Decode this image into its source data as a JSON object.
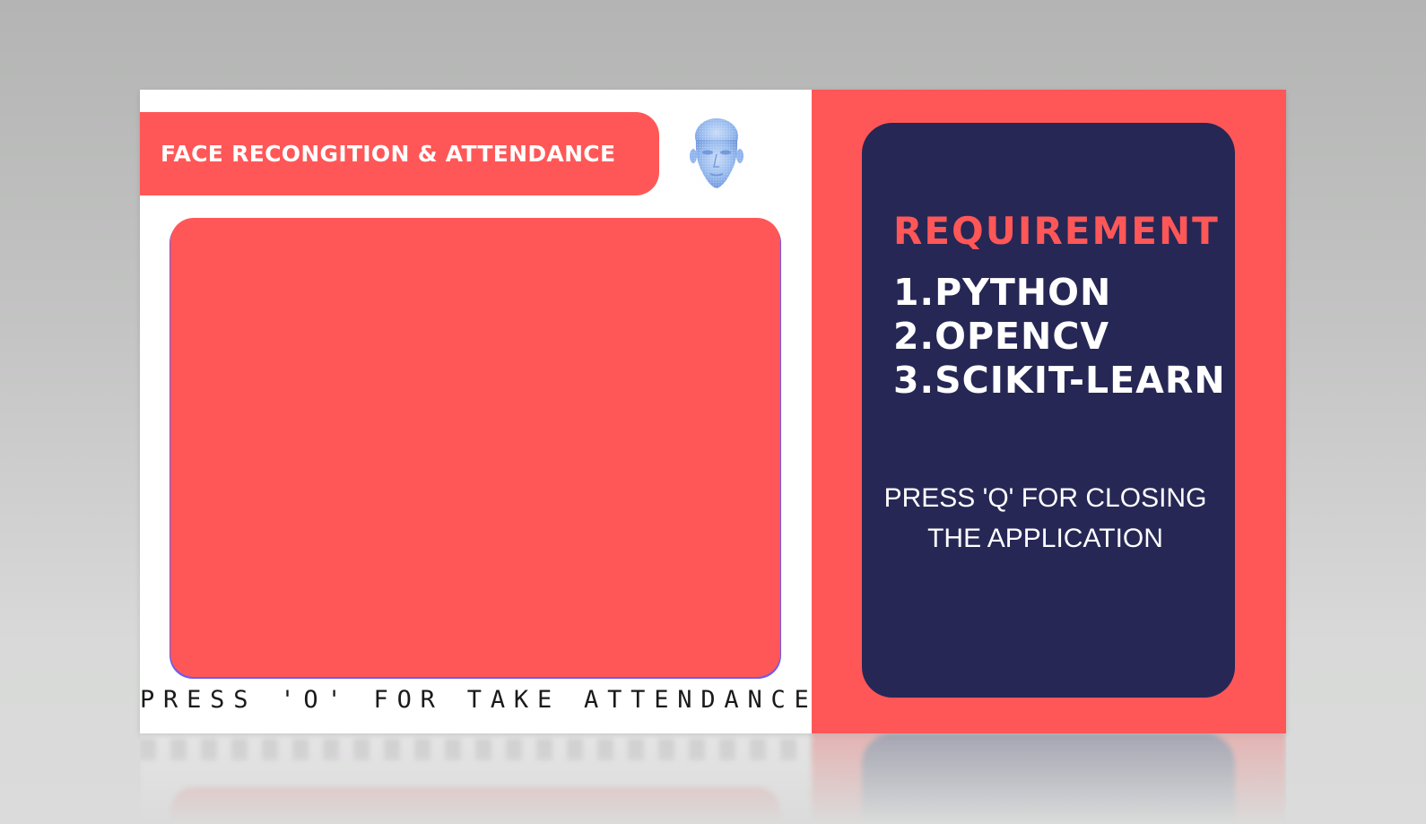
{
  "title": "FACE RECONGITION & ATTENDANCE",
  "logo_icon": "face-head-icon",
  "camera_hint": "PRESS 'O' FOR TAKE ATTENDANCE",
  "requirements": {
    "heading": "REQUIREMENT",
    "items": [
      "1.PYTHON",
      "2.OPENCV",
      "3.SCIKIT-LEARN"
    ]
  },
  "close_hint": "PRESS 'Q' FOR CLOSING THE APPLICATION",
  "colors": {
    "accent": "#ff5757",
    "navy": "#262755",
    "face_icon": "#8fb4ee"
  }
}
